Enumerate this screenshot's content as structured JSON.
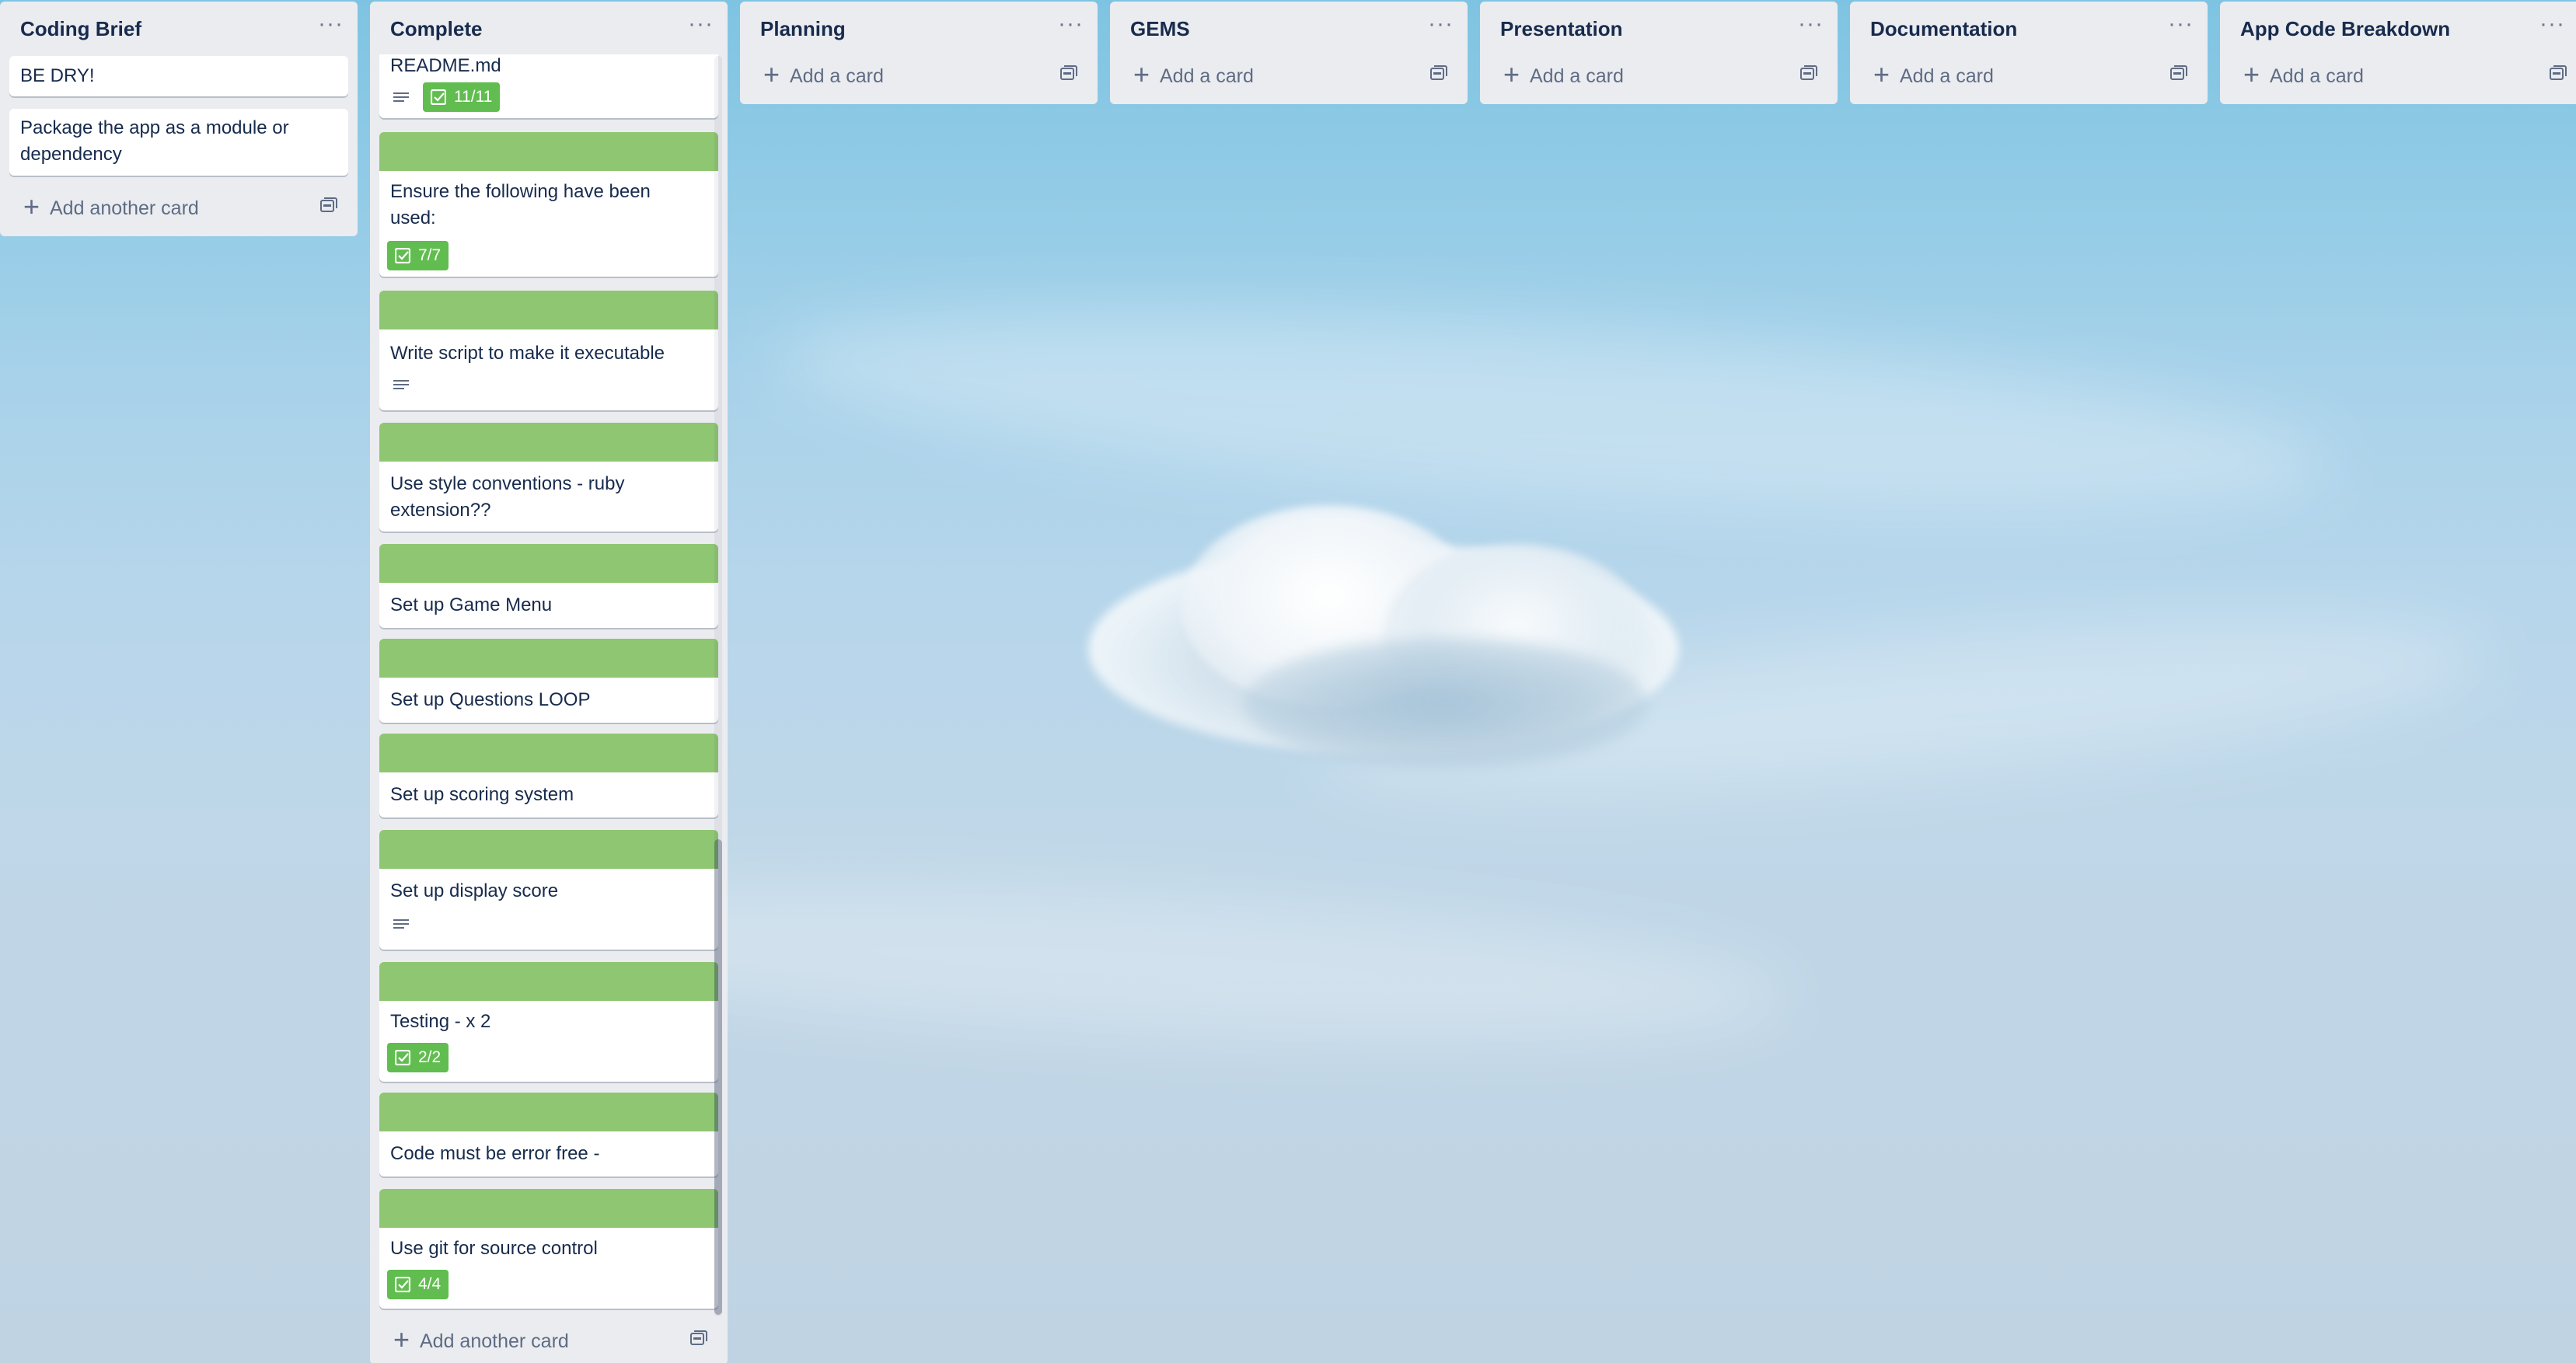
{
  "board": {
    "background": "sky with cloud",
    "lists": [
      {
        "title": "Coding Brief",
        "cards": [
          {
            "text": "BE DRY!"
          },
          {
            "text": "Package the app as a module or dependency"
          }
        ],
        "add_label": "Add another card"
      },
      {
        "title": "Complete",
        "cards": [
          {
            "text": "README.md",
            "has_description": true,
            "checklist": "11/11"
          },
          {
            "text": "Ensure the following have been used:",
            "checklist": "7/7"
          },
          {
            "text": "Write script to make it executable",
            "has_description": true
          },
          {
            "text": "Use style conventions - ruby extension??"
          },
          {
            "text": "Set up Game Menu"
          },
          {
            "text": "Set up Questions LOOP"
          },
          {
            "text": "Set up scoring system"
          },
          {
            "text": "Set up display score",
            "has_description": true
          },
          {
            "text": "Testing - x 2",
            "checklist": "2/2"
          },
          {
            "text": "Code must be error free -"
          },
          {
            "text": "Use git for source control",
            "checklist": "4/4"
          }
        ],
        "add_label": "Add another card"
      },
      {
        "title": "Planning",
        "cards": [],
        "add_label": "Add a card"
      },
      {
        "title": "GEMS",
        "cards": [],
        "add_label": "Add a card"
      },
      {
        "title": "Presentation",
        "cards": [],
        "add_label": "Add a card"
      },
      {
        "title": "Documentation",
        "cards": [],
        "add_label": "Add a card"
      },
      {
        "title": "App Code Breakdown",
        "cards": [],
        "add_label": "Add a card"
      }
    ]
  },
  "colors": {
    "list_bg": "#ebecf0",
    "label_green": "#8fc672",
    "badge_green": "#61bd4f",
    "text": "#172b4d",
    "muted": "#5e6c84"
  },
  "icons": {
    "list_menu": "ellipsis-icon",
    "add": "plus-icon",
    "template": "card-template-icon",
    "description": "description-icon",
    "checklist": "checklist-icon"
  }
}
